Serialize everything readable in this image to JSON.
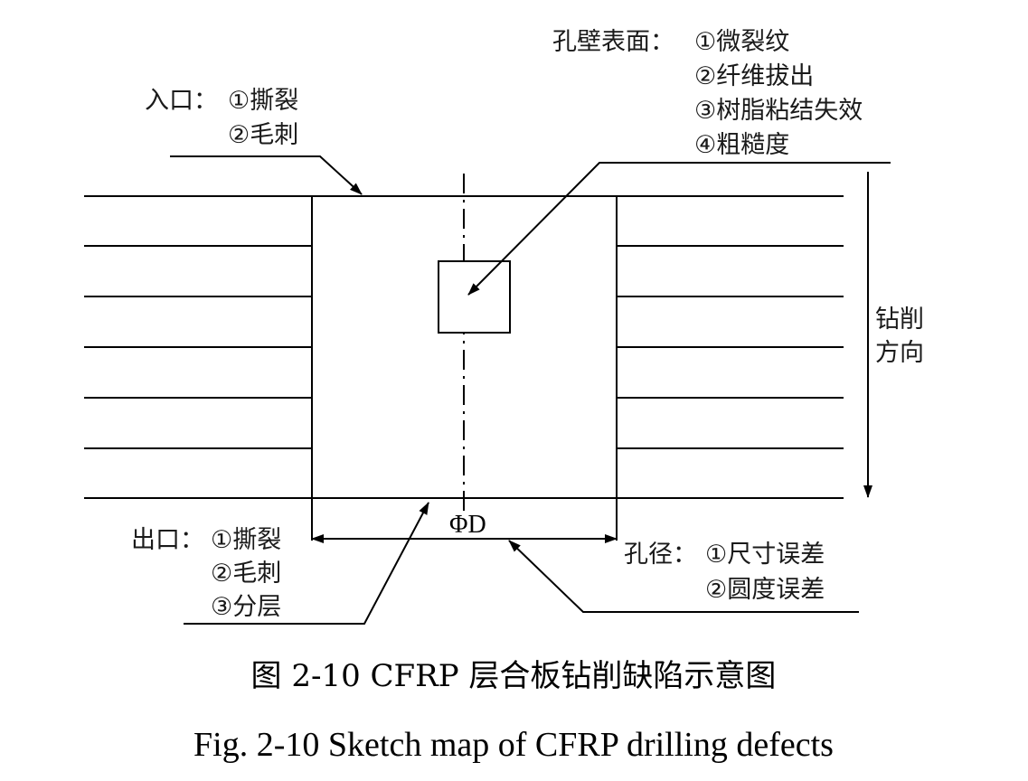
{
  "labels": {
    "entry_title": "入口：",
    "entry_item_1": "①撕裂",
    "entry_item_2": "②毛刺",
    "wall_title": "孔壁表面：",
    "wall_item_1": "①微裂纹",
    "wall_item_2": "②纤维拔出",
    "wall_item_3": "③树脂粘结失效",
    "wall_item_4": "④粗糙度",
    "direction_line_1": "钻削",
    "direction_line_2": "方向",
    "exit_title": "出口：",
    "exit_item_1": "①撕裂",
    "exit_item_2": "②毛刺",
    "exit_item_3": "③分层",
    "diameter_title": "孔径：",
    "diameter_item_1": "①尺寸误差",
    "diameter_item_2": "②圆度误差",
    "diameter_symbol": "ΦD"
  },
  "caption": {
    "chinese": "图 2-10 CFRP 层合板钻削缺陷示意图",
    "english": "Fig. 2-10 Sketch map of CFRP drilling defects"
  }
}
